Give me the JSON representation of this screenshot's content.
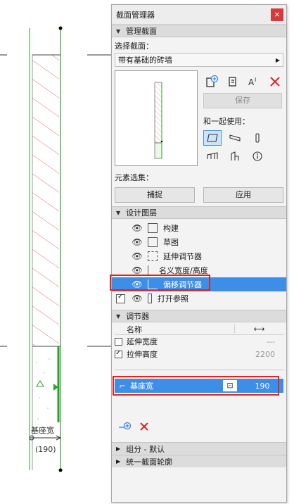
{
  "drawing": {
    "label": "基座宽",
    "dimension": "(190)"
  },
  "panel": {
    "title": "截面管理器",
    "close_icon": "×",
    "section_manage": "管理截面",
    "select_label": "选择截面：",
    "profile_value": "带有基础的砖墙",
    "save_label": "保存",
    "use_with_label": "和一起使用：",
    "element_selection_label": "元素选集：",
    "capture_label": "捕捉",
    "apply_label": "应用",
    "section_design_layers": "设计图层",
    "layers": [
      {
        "label": "构建",
        "checked": false
      },
      {
        "label": "草图",
        "checked": false
      },
      {
        "label": "延伸调节器",
        "checked": false
      },
      {
        "label": "名义宽度/高度",
        "checked": false
      },
      {
        "label": "偏移调节器",
        "checked": false,
        "selected": true
      },
      {
        "label": "打开参照",
        "checked": true
      }
    ],
    "section_adjusters": "调节器",
    "adj_name_col": "名称",
    "adjusters": [
      {
        "name": "延伸宽度",
        "value": "---",
        "checked": false
      },
      {
        "name": "拉伸高度",
        "value": "2200",
        "checked": true
      }
    ],
    "offset_name": "基座宽",
    "offset_value": "190",
    "section_group": "组分 - 默认",
    "section_unify": "统一截面轮廓"
  }
}
